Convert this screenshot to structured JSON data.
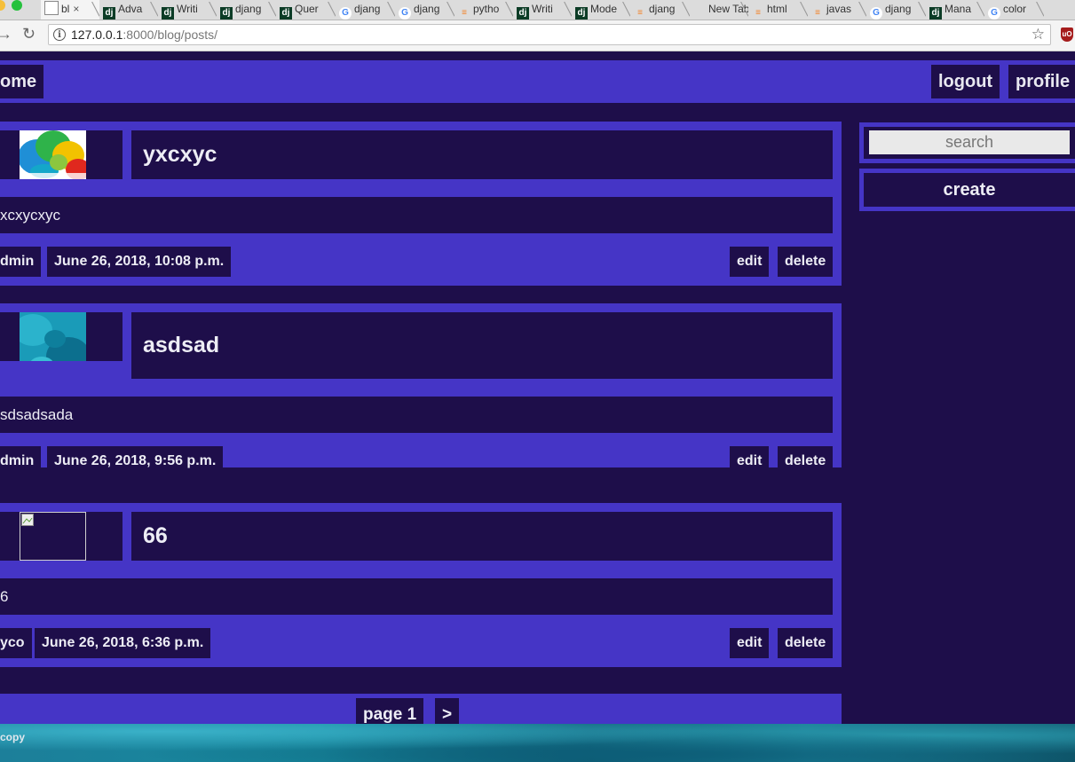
{
  "browser": {
    "tabs": [
      {
        "label": "bl",
        "icon": "page-icon",
        "active": true
      },
      {
        "label": "Adva",
        "icon": "django-icon"
      },
      {
        "label": "Writi",
        "icon": "django-icon"
      },
      {
        "label": "djang",
        "icon": "django-icon"
      },
      {
        "label": "Quer",
        "icon": "django-icon"
      },
      {
        "label": "djang",
        "icon": "google-icon"
      },
      {
        "label": "djang",
        "icon": "google-icon"
      },
      {
        "label": "pytho",
        "icon": "stackoverflow-icon"
      },
      {
        "label": "Writi",
        "icon": "django-icon"
      },
      {
        "label": "Mode",
        "icon": "django-icon"
      },
      {
        "label": "djang",
        "icon": "stackoverflow-icon"
      },
      {
        "label": "New Tab",
        "icon": "none"
      },
      {
        "label": "html",
        "icon": "stackoverflow-icon"
      },
      {
        "label": "javas",
        "icon": "stackoverflow-icon"
      },
      {
        "label": "djang",
        "icon": "google-icon"
      },
      {
        "label": "Mana",
        "icon": "django-icon"
      },
      {
        "label": "color",
        "icon": "google-icon"
      }
    ],
    "url_host": "127.0.0.1",
    "url_rest": ":8000/blog/posts/"
  },
  "nav": {
    "home_label": "ome",
    "logout_label": "logout",
    "profile_label": "profile"
  },
  "sidebar": {
    "search_placeholder": "search",
    "create_label": "create"
  },
  "posts": [
    {
      "title": "yxcxyc",
      "body": "xcxycxyc",
      "author": "dmin",
      "date": "June 26, 2018, 10:08 p.m.",
      "edit_label": "edit",
      "delete_label": "delete"
    },
    {
      "title": "asdsad",
      "body": "sdsadsada",
      "author": "dmin",
      "date": "June 26, 2018, 9:56 p.m.",
      "edit_label": "edit",
      "delete_label": "delete"
    },
    {
      "title": "66",
      "body": "6",
      "author": "yco",
      "date": "June 26, 2018, 6:36 p.m.",
      "edit_label": "edit",
      "delete_label": "delete"
    }
  ],
  "pagination": {
    "page_label": "page 1",
    "next_label": ">"
  },
  "footer": {
    "text": "copy"
  },
  "colors": {
    "page_bg": "#1e0e4a",
    "accent": "#4535c6",
    "text": "#ededf5"
  }
}
